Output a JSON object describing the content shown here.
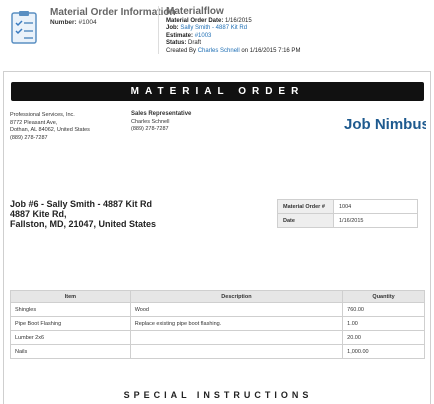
{
  "header": {
    "title": "Material Order Information",
    "number_label": "Number:",
    "number_value": "#1004"
  },
  "materialflow": {
    "title": "Materialflow",
    "order_date_label": "Material Order Date:",
    "order_date_value": "1/16/2015",
    "job_label": "Job:",
    "job_value": "Sally Smith - 4887 Kit Rd",
    "estimate_label": "Estimate:",
    "estimate_value": "#1003",
    "status_label": "Status:",
    "status_value": "Draft",
    "created_prefix": "Created By",
    "created_by": "Charles Schnell",
    "created_suffix": "on 1/16/2015 7:16 PM"
  },
  "banner": "MATERIAL ORDER",
  "company": {
    "name": "Professional Services, Inc.",
    "street": "8772 Pleasant Ave,",
    "city": "Dothan, AL 84062, United States",
    "phone": "(889) 278-7287"
  },
  "sales_rep": {
    "heading": "Sales Representative",
    "name": "Charles Schnell",
    "phone": "(889) 278-7287"
  },
  "logo_text": "Job Nimbus",
  "job": {
    "line1": "Job #6 - Sally Smith - 4887 Kit Rd",
    "line2": "4887 Kite Rd,",
    "line3": "Fallston, MD, 21047, United States"
  },
  "order_info": {
    "order_label": "Material Order #",
    "order_value": "1004",
    "date_label": "Date",
    "date_value": "1/16/2015"
  },
  "items_table": {
    "headers": [
      "Item",
      "Description",
      "Quantity"
    ],
    "rows": [
      {
        "item": "Shingles",
        "description": "Wood",
        "quantity": "760.00"
      },
      {
        "item": "Pipe Boot Flashing",
        "description": "Replace existing pipe boot flashing.",
        "quantity": "1.00"
      },
      {
        "item": "Lumber 2x6",
        "description": "",
        "quantity": "20.00"
      },
      {
        "item": "Nails",
        "description": "",
        "quantity": "1,000.00"
      }
    ]
  },
  "special_instructions": "SPECIAL INSTRUCTIONS",
  "colors": {
    "banner_bg": "#111111",
    "link": "#1f6fb5",
    "logo_blue": "#1e5a8f"
  }
}
